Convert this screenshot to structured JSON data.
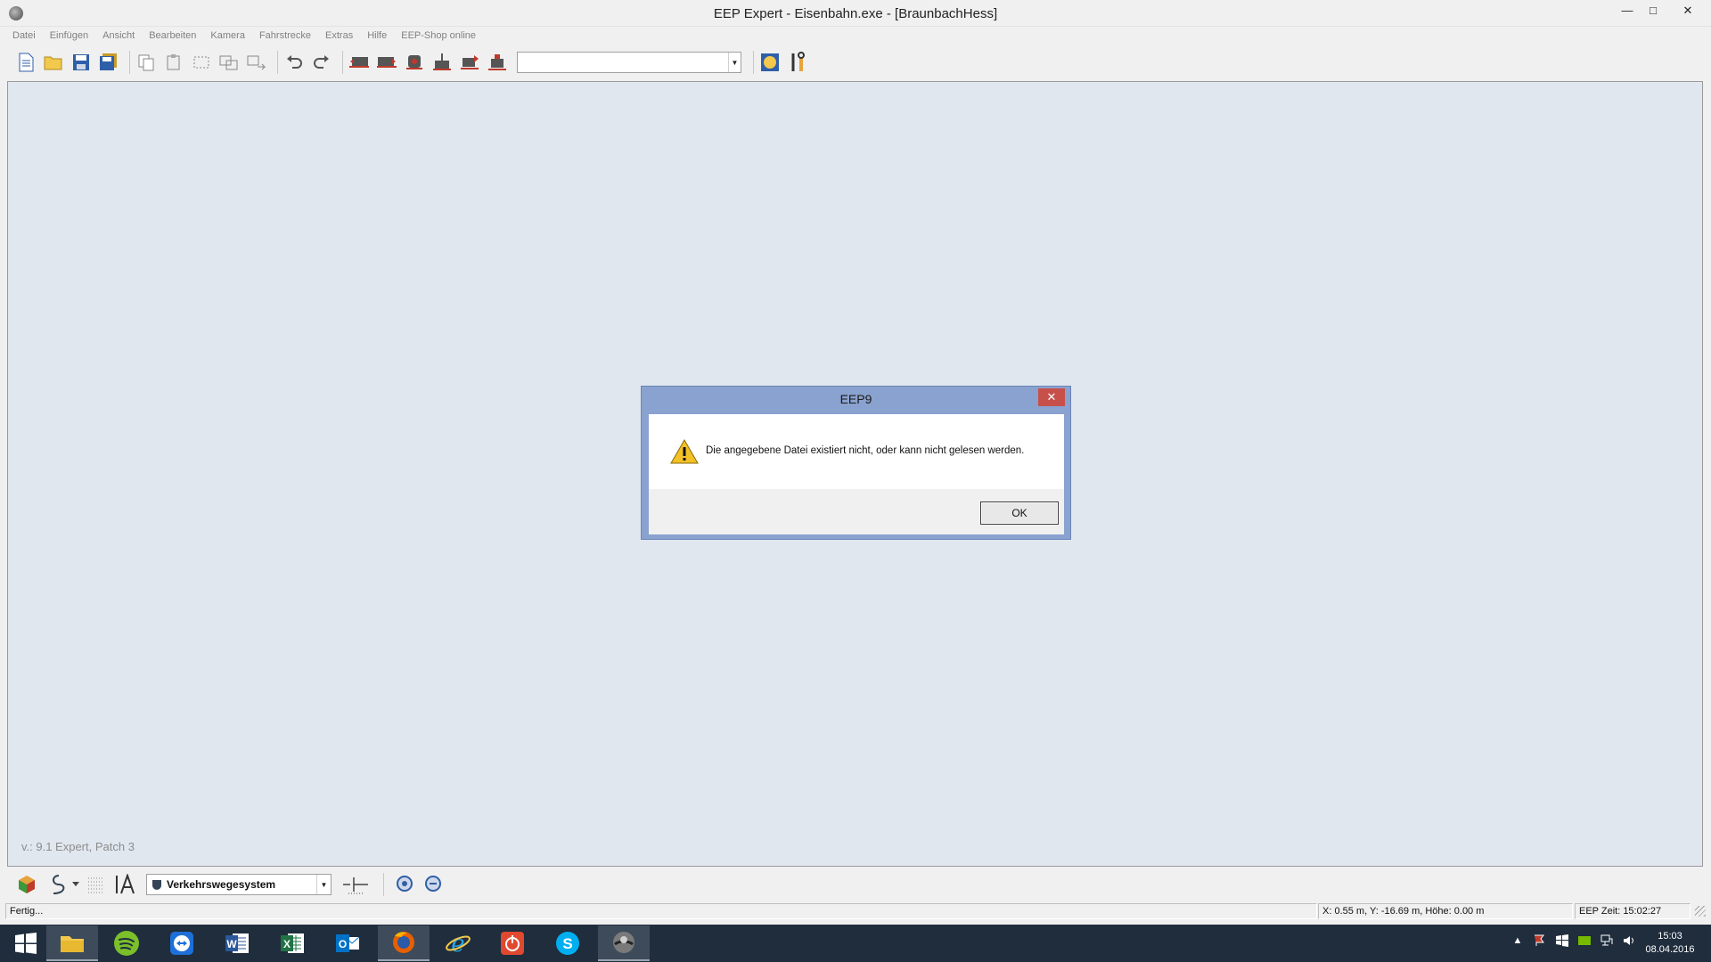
{
  "window": {
    "title": "EEP Expert - Eisenbahn.exe - [BraunbachHess]",
    "minimize": "—",
    "maximize": "□",
    "close": "✕"
  },
  "menu": [
    "Datei",
    "Einfügen",
    "Ansicht",
    "Bearbeiten",
    "Kamera",
    "Fahrstrecke",
    "Extras",
    "Hilfe",
    "EEP-Shop online"
  ],
  "toolbar": {
    "combo_value": "",
    "icons": [
      "new-file-icon",
      "open-folder-icon",
      "save-icon",
      "save-all-icon",
      "copy-icon",
      "paste-icon",
      "select-rect-icon",
      "duplicate-icon",
      "move-icon",
      "undo-icon",
      "redo-icon",
      "train-left-icon",
      "train-right-icon",
      "train-front-icon",
      "train-crane-icon",
      "train-arrow-icon",
      "train-camera-icon",
      "globe-icon",
      "tools-icon"
    ]
  },
  "canvas": {
    "version": "v.: 9.1 Expert, Patch 3",
    "background": "#e1e7ef"
  },
  "dialog": {
    "title": "EEP9",
    "message": "Die angegebene Datei existiert nicht, oder kann nicht gelesen werden.",
    "ok_label": "OK",
    "close": "✕"
  },
  "bottom_toolbar": {
    "layer_select": "Verkehrswegesystem"
  },
  "statusbar": {
    "status": "Fertig...",
    "coords": "X: 0.55 m, Y: -16.69 m, Höhe: 0.00 m",
    "eep_time": "EEP Zeit: 15:02:27"
  },
  "taskbar": {
    "clock_time": "15:03",
    "clock_date": "08.04.2016"
  }
}
